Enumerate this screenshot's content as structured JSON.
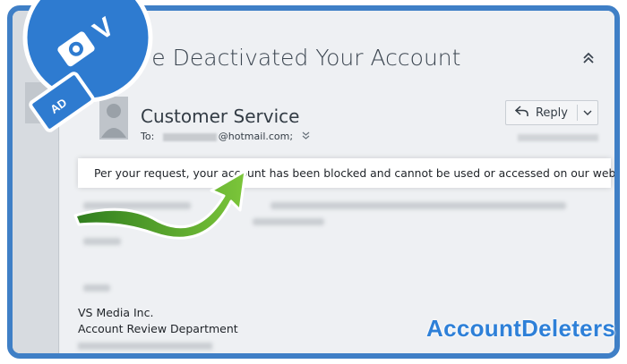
{
  "email": {
    "subject": "We've Deactivated Your Account",
    "sender": "Customer Service",
    "to_prefix": "To:",
    "to_address": "@hotmail.com;",
    "reply_label": "Reply",
    "highlighted_message": "Per your request, your account has been blocked and cannot be used or accessed on our website.",
    "signature": {
      "company": "VS Media Inc.",
      "department": "Account Review Department"
    }
  },
  "overlay": {
    "watermark": "AccountDeleters",
    "arrow_color": "#5fae2e",
    "brand_blue": "#3f7fc6",
    "badge_letter": "V",
    "badge_icon_text": "AD"
  },
  "icons": {
    "collapse": "chevron-up-icon",
    "reply": "reply-arrow-icon",
    "reply_menu": "chevron-down-icon",
    "expand_recipients": "double-chevron-down-icon"
  }
}
